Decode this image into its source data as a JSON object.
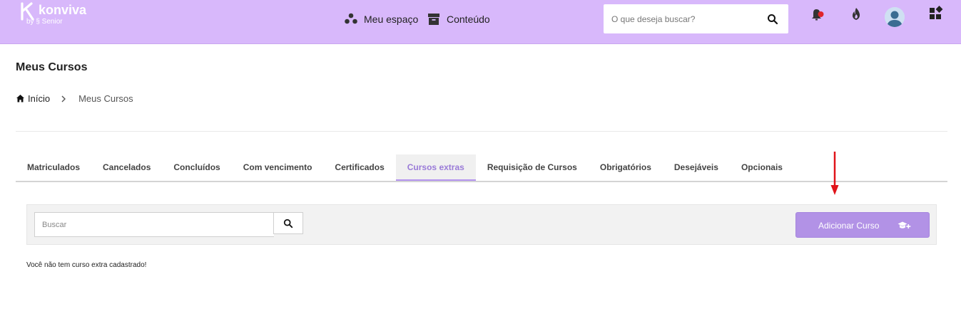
{
  "header": {
    "logo_text": "konviva",
    "logo_sub": "by § Senior",
    "nav": {
      "meu_espaco": "Meu espaço",
      "conteudo": "Conteúdo"
    },
    "search_placeholder": "O que deseja buscar?",
    "icons": [
      "bell-icon",
      "fire-icon",
      "avatar",
      "apps-icon"
    ],
    "colors": {
      "bar": "#d8b8fb",
      "notification_dot": "#e0242a"
    }
  },
  "page": {
    "title": "Meus Cursos",
    "breadcrumb": {
      "home": "Início",
      "current": "Meus Cursos"
    }
  },
  "tabs": [
    {
      "label": "Matriculados"
    },
    {
      "label": "Cancelados"
    },
    {
      "label": "Concluídos"
    },
    {
      "label": "Com vencimento"
    },
    {
      "label": "Certificados"
    },
    {
      "label": "Cursos extras",
      "active": true
    },
    {
      "label": "Requisição de Cursos"
    },
    {
      "label": "Obrigatórios"
    },
    {
      "label": "Desejáveis"
    },
    {
      "label": "Opcionais"
    }
  ],
  "toolbar": {
    "search_placeholder": "Buscar",
    "add_button": "Adicionar Curso",
    "accent": "#b292e6"
  },
  "empty_message": "Você não tem curso extra cadastrado!"
}
